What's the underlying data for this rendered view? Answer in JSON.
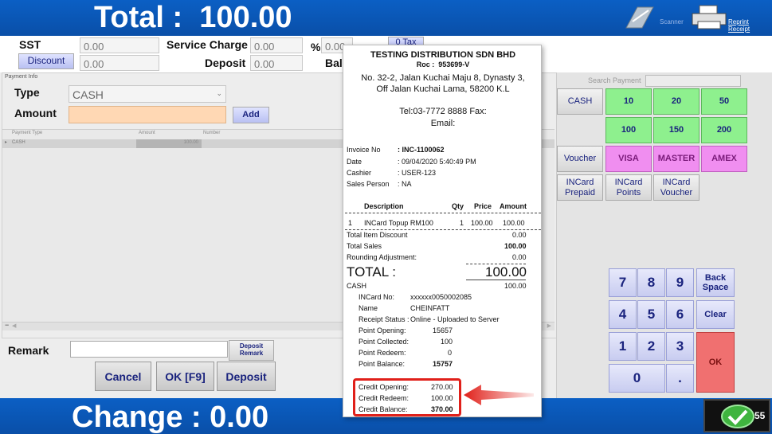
{
  "header": {
    "total_label": "Total :",
    "total_value": "100.00",
    "scanner_label": "Scanner",
    "reprint_label": "Reprint Receipt"
  },
  "charges": {
    "sst_label": "SST",
    "sst_value": "0.00",
    "service_label": "Service Charge",
    "service_value": "0.00",
    "percent_label": "%",
    "percent_value": "0.00",
    "tax_button": "0 Tax",
    "discount_button": "Discount",
    "discount_value": "0.00",
    "deposit_label": "Deposit",
    "deposit_value": "0.00",
    "balance_label": "Bala"
  },
  "payment_info": {
    "group_label": "Payment Info",
    "type_label": "Type",
    "type_value": "CASH",
    "amount_label": "Amount",
    "amount_value": "",
    "add_button": "Add",
    "grid_headers": [
      "Payment Type",
      "Amount",
      "Number"
    ],
    "grid_rows": [
      {
        "type": "CASH",
        "amount": "100.00",
        "number": ""
      }
    ]
  },
  "remark": {
    "label": "Remark",
    "value": "",
    "deposit_remark_button": "Deposit Remark"
  },
  "actions": {
    "cancel": "Cancel",
    "ok": "OK [F9]",
    "deposit": "Deposit"
  },
  "footer": {
    "change_label": "Change :",
    "change_value": "0.00",
    "badge_value": "55"
  },
  "right_panel": {
    "search_label": "Search Payment",
    "search_value": "",
    "cash": "CASH",
    "amounts": [
      "10",
      "20",
      "50",
      "100",
      "150",
      "200"
    ],
    "voucher": "Voucher",
    "cards": [
      "VISA",
      "MASTER",
      "AMEX"
    ],
    "incard_prepaid": "INCard Prepaid",
    "incard_points": "INCard Points",
    "incard_voucher": "INCard Voucher",
    "keypad": [
      "7",
      "8",
      "9",
      "4",
      "5",
      "6",
      "1",
      "2",
      "3",
      "0",
      "."
    ],
    "backspace": "Back Space",
    "clear": "Clear",
    "ok": "OK"
  },
  "receipt": {
    "company": "TESTING DISTRIBUTION SDN BHD",
    "roc_label": "Roc :",
    "roc_value": "953699-V",
    "address1": "No. 32-2, Jalan Kuchai Maju 8, Dynasty 3,",
    "address2": "Off Jalan Kuchai Lama, 58200 K.L",
    "tel": "Tel:03-7772 8888 Fax:",
    "email": "Email:",
    "info": [
      {
        "label": "Invoice No",
        "value": ": INC-1100062"
      },
      {
        "label": "Date",
        "value": ": 09/04/2020 5:40:49 PM"
      },
      {
        "label": "Cashier",
        "value": ": USER-123"
      },
      {
        "label": "Sales Person",
        "value": ": NA"
      }
    ],
    "columns": {
      "description": "Description",
      "qty": "Qty",
      "price": "Price",
      "amount": "Amount"
    },
    "item": {
      "no": "1",
      "description": "INCard Topup RM100",
      "qty": "1",
      "price": "100.00",
      "amount": "100.00"
    },
    "summary": [
      {
        "label": "Total Item Discount",
        "value": "0.00"
      },
      {
        "label": "Total Sales",
        "value": "100.00"
      },
      {
        "label": "Rounding Adjustment:",
        "value": "0.00"
      }
    ],
    "total_label": "TOTAL :",
    "total_value": "100.00",
    "payment_label": "CASH",
    "payment_value": "100.00",
    "incard": [
      {
        "label": "INCard No:",
        "value": "xxxxxx0050002085"
      },
      {
        "label": "Name",
        "value": "CHEINFATT"
      },
      {
        "label": "Receipt Status :",
        "value": "Online - Uploaded to Server"
      },
      {
        "label": "Point Opening:",
        "value": "15657"
      },
      {
        "label": "Point Collected:",
        "value": "100"
      },
      {
        "label": "Point Redeem:",
        "value": "0"
      },
      {
        "label": "Point Balance:",
        "value": "15757"
      }
    ],
    "credit": [
      {
        "label": "Credit Opening:",
        "value": "270.00"
      },
      {
        "label": "Credit Redeem:",
        "value": "100.00"
      },
      {
        "label": "Credit Balance:",
        "value": "370.00"
      }
    ]
  },
  "colors": {
    "header_blue": "#0b5fc4",
    "highlight_red": "#e0201a",
    "green_button": "#8ef08e",
    "magenta_button": "#f08ef0",
    "ok_red": "#f07070"
  }
}
